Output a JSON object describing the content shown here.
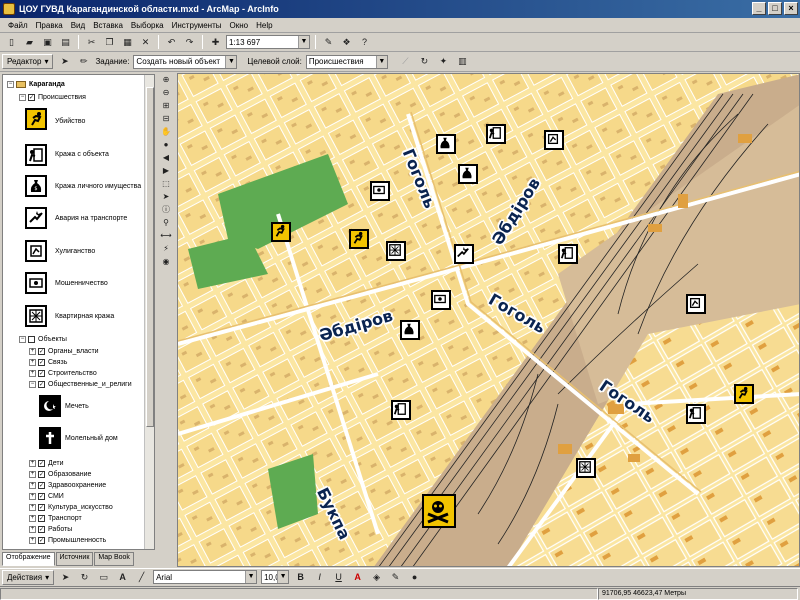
{
  "window": {
    "title": "ЦОУ ГУВД Карагандинской области.mxd - ArcMap - ArcInfo",
    "buttons": [
      "_",
      "□",
      "×"
    ]
  },
  "menu": [
    "Файл",
    "Правка",
    "Вид",
    "Вставка",
    "Выборка",
    "Инструменты",
    "Окно",
    "Help"
  ],
  "toolbar": {
    "scale": "1:13 697"
  },
  "editor": {
    "editor_label": "Редактор",
    "task_label": "Задание:",
    "task_value": "Создать новый объект",
    "target_label": "Целевой слой:",
    "target_value": "Происшествия"
  },
  "toc": {
    "root": "Караганда",
    "incidents_group": "Происшествия",
    "incidents": [
      "Убийство",
      "Кража с объекта",
      "Кража личного имущества",
      "Авария на транспорте",
      "Хулиганство",
      "Мошенничество",
      "Квартирная кража"
    ],
    "objects_group": "Объекты",
    "objects_top": [
      "Органы_власти",
      "Связь",
      "Строительство",
      "Общественные_и_религи"
    ],
    "religious": [
      "Мечеть",
      "Молельный дом"
    ],
    "objects_bottom": [
      "Дети",
      "Образование",
      "Здравоохранение",
      "СМИ",
      "Культура_искусство",
      "Транспорт",
      "Работы",
      "Промышленность"
    ],
    "tabs": [
      "Отображение",
      "Источник",
      "Map Book"
    ]
  },
  "map": {
    "streets": [
      "Гоголь",
      "Әбдіров",
      "Әбдіров",
      "Гоголь",
      "Гоголь",
      "Букпа"
    ]
  },
  "drawing": {
    "actions_label": "Действия",
    "font_name": "Arial",
    "font_size": "10,0",
    "bold": "B",
    "italic": "I",
    "underline": "U",
    "letter": "A"
  },
  "status": {
    "coords": "91706,95  46623,47 Метры"
  },
  "colors": {
    "map_bg": "#fbe6a2",
    "block": "#f6d98a",
    "green": "#5eab52",
    "rail": "#c9ad8c",
    "marker_yellow": "#f2c400",
    "street_text": "#0a2450"
  }
}
